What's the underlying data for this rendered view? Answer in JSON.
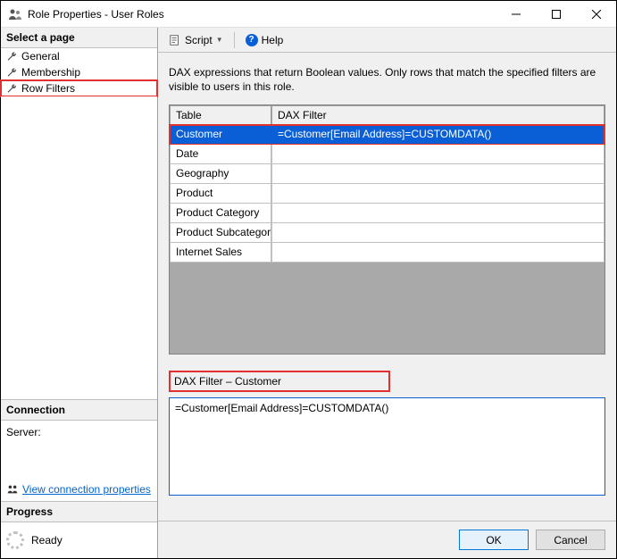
{
  "window": {
    "title": "Role Properties - User Roles"
  },
  "sidebar": {
    "select_page_header": "Select a page",
    "pages": {
      "general": "General",
      "membership": "Membership",
      "row_filters": "Row Filters"
    },
    "connection_header": "Connection",
    "server_label": "Server:",
    "server_value": "",
    "view_conn_link": "View connection properties",
    "progress_header": "Progress",
    "progress_status": "Ready"
  },
  "toolbar": {
    "script_label": "Script",
    "help_label": "Help"
  },
  "content": {
    "description": "DAX expressions that return Boolean values. Only rows that match the specified filters are visible to users in this role.",
    "columns": {
      "table": "Table",
      "dax_filter": "DAX Filter"
    },
    "rows": [
      {
        "table": "Customer",
        "filter": "=Customer[Email Address]=CUSTOMDATA()"
      },
      {
        "table": "Date",
        "filter": ""
      },
      {
        "table": "Geography",
        "filter": ""
      },
      {
        "table": "Product",
        "filter": ""
      },
      {
        "table": "Product Category",
        "filter": ""
      },
      {
        "table": "Product Subcategory",
        "filter": ""
      },
      {
        "table": "Internet Sales",
        "filter": ""
      }
    ],
    "filter_editor_label": "DAX Filter – Customer",
    "filter_editor_value": "=Customer[Email Address]=CUSTOMDATA()"
  },
  "buttons": {
    "ok": "OK",
    "cancel": "Cancel"
  }
}
